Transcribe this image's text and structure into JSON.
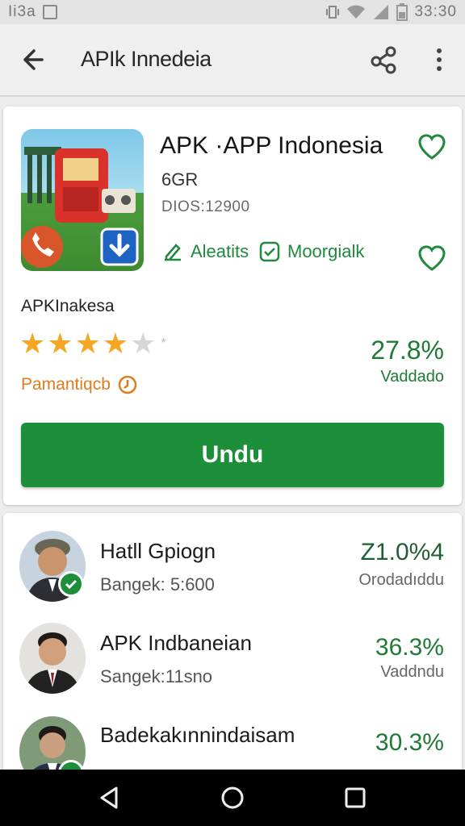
{
  "status_bar": {
    "left_text": "Ii3a",
    "time": "33:30"
  },
  "app_bar": {
    "search_title": "APIk Innedeia"
  },
  "app": {
    "title": "APK ·APP Indonesia",
    "size": "6GR",
    "downloads": "DIOS:12900",
    "tag_left": "Aleatits",
    "tag_right": "Moorgialk",
    "developer": "APKInakesa",
    "stars_filled": 4,
    "stars_total": 5,
    "star_extra": "*",
    "badge_text": "Pamantiqcb",
    "rating_value": "27.8%",
    "rating_label": "Vaddado",
    "install_label": "Undu"
  },
  "list": [
    {
      "name": "Hatll Gpiogn",
      "sub": "Bangek: 5:600",
      "value": "Z1.0%4",
      "label": "Orodadıddu",
      "verified": true
    },
    {
      "name": "APK Indbaneian",
      "sub": "Sangek:11sno",
      "value": "36.3%",
      "label": "Vaddndu",
      "verified": false
    },
    {
      "name": "Badekakınnindaisam",
      "sub": "",
      "value": "30.3%",
      "label": "",
      "verified": true
    }
  ],
  "colors": {
    "accent_green": "#1d8f3a",
    "star_orange": "#f5a623",
    "badge_orange": "#e07b1e"
  }
}
